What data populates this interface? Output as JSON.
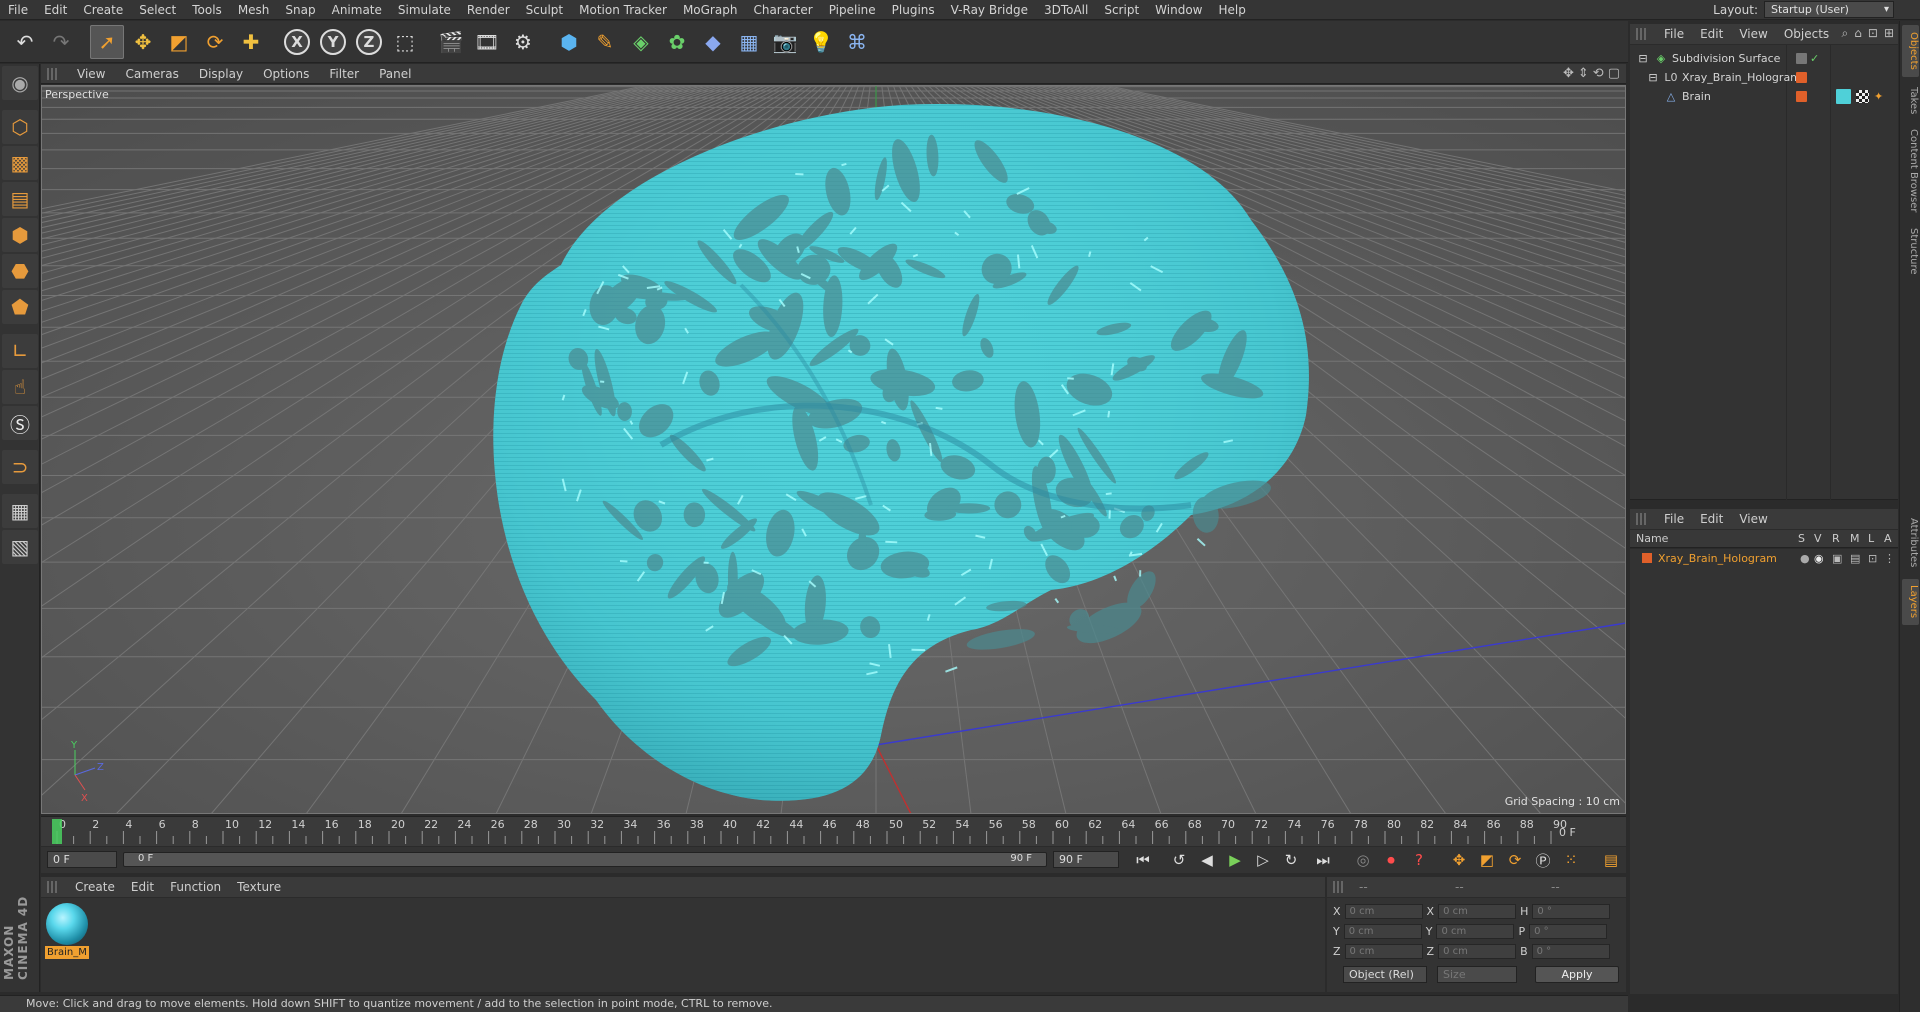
{
  "menu": [
    "File",
    "Edit",
    "Create",
    "Select",
    "Tools",
    "Mesh",
    "Snap",
    "Animate",
    "Simulate",
    "Render",
    "Sculpt",
    "Motion Tracker",
    "MoGraph",
    "Character",
    "Pipeline",
    "Plugins",
    "V-Ray Bridge",
    "3DToAll",
    "Script",
    "Window",
    "Help"
  ],
  "layout": {
    "label": "Layout:",
    "value": "Startup (User)"
  },
  "toolbar": {
    "axis_x": "X",
    "axis_y": "Y",
    "axis_z": "Z"
  },
  "viewport": {
    "menu": [
      "View",
      "Cameras",
      "Display",
      "Options",
      "Filter",
      "Panel"
    ],
    "label": "Perspective",
    "grid_spacing": "Grid Spacing : 10 cm"
  },
  "timeline": {
    "ticks": [
      0,
      2,
      4,
      6,
      8,
      10,
      12,
      14,
      16,
      18,
      20,
      22,
      24,
      26,
      28,
      30,
      32,
      34,
      36,
      38,
      40,
      42,
      44,
      46,
      48,
      50,
      52,
      54,
      56,
      58,
      60,
      62,
      64,
      66,
      68,
      70,
      72,
      74,
      76,
      78,
      80,
      82,
      84,
      86,
      88,
      90
    ],
    "end_display": "0 F",
    "current_frame": "0 F",
    "range_start": "0 F",
    "range_end": "90 F",
    "end_frame": "90 F"
  },
  "material_manager": {
    "menu": [
      "Create",
      "Edit",
      "Function",
      "Texture"
    ],
    "materials": [
      {
        "name": "Brain_M"
      }
    ]
  },
  "coordinates": {
    "header": [
      "--",
      "--",
      "--"
    ],
    "rows": [
      {
        "a": "X",
        "v1": "0 cm",
        "b": "X",
        "v2": "0 cm",
        "c": "H",
        "v3": "0 °"
      },
      {
        "a": "Y",
        "v1": "0 cm",
        "b": "Y",
        "v2": "0 cm",
        "c": "P",
        "v3": "0 °"
      },
      {
        "a": "Z",
        "v1": "0 cm",
        "b": "Z",
        "v2": "0 cm",
        "c": "B",
        "v3": "0 °"
      }
    ],
    "mode": "Object (Rel)",
    "size": "Size",
    "apply": "Apply"
  },
  "objects_panel": {
    "menu": [
      "File",
      "Edit",
      "View",
      "Objects"
    ],
    "items": [
      {
        "name": "Subdivision Surface",
        "depth": 0
      },
      {
        "name": "Xray_Brain_Hologram",
        "depth": 1
      },
      {
        "name": "Brain",
        "depth": 2
      }
    ]
  },
  "layers_panel": {
    "menu": [
      "File",
      "Edit",
      "View"
    ],
    "columns": {
      "name": "Name",
      "s": "S",
      "v": "V",
      "r": "R",
      "m": "M",
      "l": "L",
      "a": "A"
    },
    "items": [
      {
        "name": "Xray_Brain_Hologram"
      }
    ]
  },
  "right_tabs": [
    "Objects",
    "Takes",
    "Content Browser",
    "Structure",
    "Attributes",
    "Layers"
  ],
  "status": "Move: Click and drag to move elements. Hold down SHIFT to quantize movement / add to the selection in point mode, CTRL to remove.",
  "brand": "MAXON CINEMA 4D",
  "colors": {
    "accent": "#f0a030",
    "hologram": "#4fd0d8",
    "viewport_bg": "#5a5a5a"
  }
}
